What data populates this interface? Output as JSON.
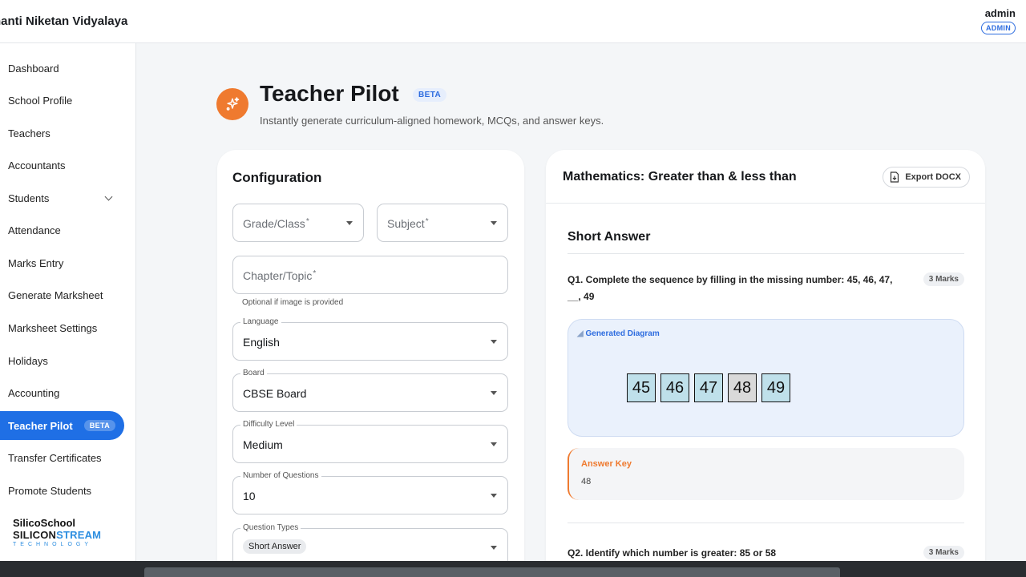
{
  "app": {
    "school_name": "hanti Niketan Vidyalaya",
    "user_name": "admin",
    "user_role": "ADMIN"
  },
  "sidebar": {
    "items": [
      {
        "label": "Dashboard"
      },
      {
        "label": "School Profile"
      },
      {
        "label": "Teachers"
      },
      {
        "label": "Accountants"
      },
      {
        "label": "Students"
      },
      {
        "label": "Attendance"
      },
      {
        "label": "Marks Entry"
      },
      {
        "label": "Generate Marksheet"
      },
      {
        "label": "Marksheet Settings"
      },
      {
        "label": "Holidays"
      },
      {
        "label": "Accounting"
      },
      {
        "label": "Teacher Pilot",
        "badge": "BETA",
        "active": true
      },
      {
        "label": "Transfer Certificates"
      },
      {
        "label": "Promote Students"
      }
    ],
    "brand": {
      "product": "SilicoSchool",
      "company_a": "SILICON",
      "company_b": "STREAM",
      "tagline": "TECHNOLOGY"
    }
  },
  "header": {
    "title": "Teacher Pilot",
    "badge": "BETA",
    "subtitle": "Instantly generate curriculum-aligned homework, MCQs, and answer keys."
  },
  "config": {
    "title": "Configuration",
    "grade_placeholder": "Grade/Class",
    "subject_placeholder": "Subject",
    "chapter_placeholder": "Chapter/Topic",
    "required_mark": "*",
    "chapter_helper": "Optional if image is provided",
    "language": {
      "label": "Language",
      "value": "English"
    },
    "board": {
      "label": "Board",
      "value": "CBSE Board"
    },
    "difficulty": {
      "label": "Difficulty Level",
      "value": "Medium"
    },
    "num_questions": {
      "label": "Number of Questions",
      "value": "10"
    },
    "question_types": {
      "label": "Question Types",
      "chip": "Short Answer"
    }
  },
  "output": {
    "title": "Mathematics: Greater than & less than",
    "export_label": "Export DOCX",
    "section": "Short Answer",
    "q1": {
      "text": "Q1. Complete the sequence by filling in the missing number: 45, 46, 47, __, 49",
      "marks": "3 Marks"
    },
    "diagram_label": "Generated Diagram",
    "diagram_numbers": [
      "45",
      "46",
      "47",
      "48",
      "49"
    ],
    "answer_key_label": "Answer Key",
    "answer_key_value": "48",
    "q2": {
      "text": "Q2. Identify which number is greater: 85 or 58",
      "marks": "3 Marks"
    }
  }
}
